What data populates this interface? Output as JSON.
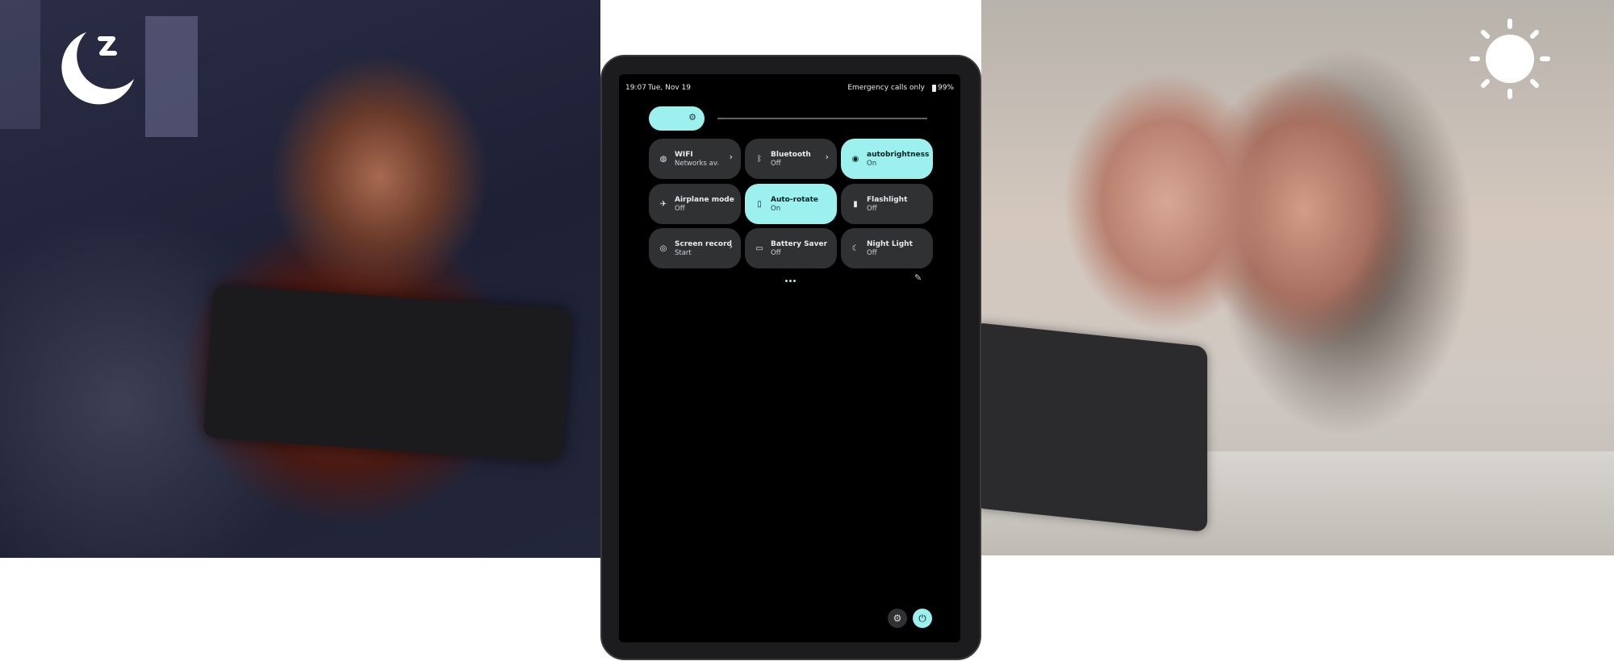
{
  "status_bar": {
    "time": "19:07",
    "date": "Tue, Nov 19",
    "network": "Emergency calls only",
    "battery": "99%"
  },
  "brightness": {
    "level_percent": 20
  },
  "tiles": [
    {
      "label": "WIFI",
      "sub": "Networks available",
      "icon": "wifi-icon",
      "on": false,
      "chevron": true
    },
    {
      "label": "Bluetooth",
      "sub": "Off",
      "icon": "bluetooth-icon",
      "on": false,
      "chevron": true
    },
    {
      "label": "autobrightness",
      "sub": "On",
      "icon": "brightness-icon",
      "on": true,
      "chevron": false
    },
    {
      "label": "Airplane mode",
      "sub": "Off",
      "icon": "airplane-icon",
      "on": false,
      "chevron": false
    },
    {
      "label": "Auto-rotate",
      "sub": "On",
      "icon": "rotate-icon",
      "on": true,
      "chevron": false
    },
    {
      "label": "Flashlight",
      "sub": "Off",
      "icon": "flashlight-icon",
      "on": false,
      "chevron": false
    },
    {
      "label": "Screen record",
      "sub": "Start",
      "icon": "screen-record-icon",
      "on": false,
      "chevron": true
    },
    {
      "label": "Battery Saver",
      "sub": "Off",
      "icon": "battery-saver-icon",
      "on": false,
      "chevron": false
    },
    {
      "label": "Night Light",
      "sub": "Off",
      "icon": "night-light-icon",
      "on": false,
      "chevron": false
    }
  ],
  "colors": {
    "accent": "#9cf0ee",
    "tile": "#2f3133"
  },
  "overlay_icons": {
    "left": "moon-sleep-icon",
    "right": "sun-icon"
  }
}
